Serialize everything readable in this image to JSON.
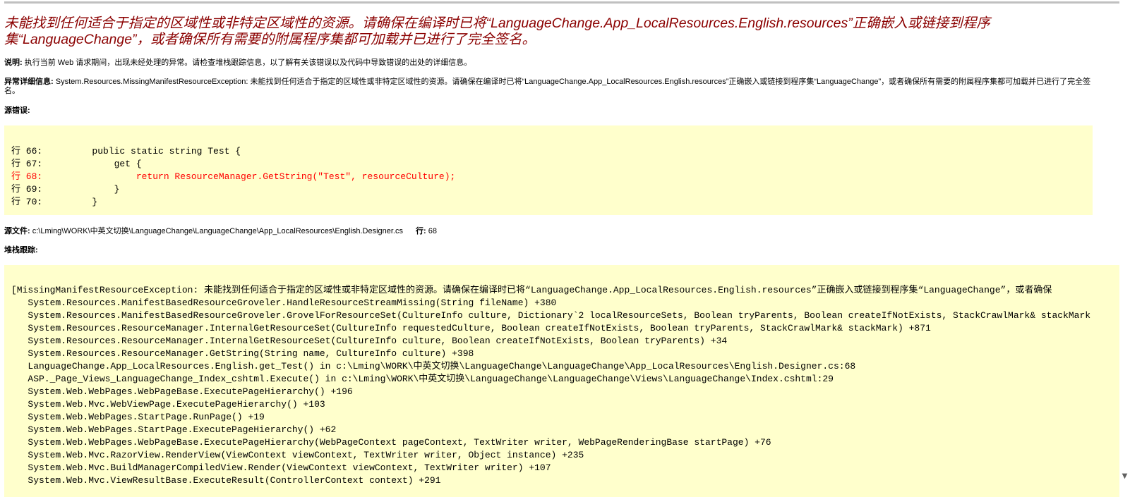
{
  "error": {
    "title": "未能找到任何适合于指定的区域性或非特定区域性的资源。请确保在编译时已将“LanguageChange.App_LocalResources.English.resources”正确嵌入或链接到程序集“LanguageChange”，或者确保所有需要的附属程序集都可加载并已进行了完全签名。",
    "description_label": "说明:",
    "description": " 执行当前 Web 请求期间，出现未经处理的异常。请检查堆栈跟踪信息，以了解有关该错误以及代码中导致错误的出处的详细信息。",
    "exception_label": "异常详细信息:",
    "exception": " System.Resources.MissingManifestResourceException: 未能找到任何适合于指定的区域性或非特定区域性的资源。请确保在编译时已将“LanguageChange.App_LocalResources.English.resources”正确嵌入或链接到程序集“LanguageChange”，或者确保所有需要的附属程序集都可加载并已进行了完全签名。",
    "source_error_label": "源错误:",
    "source_lines": [
      {
        "text": "行 66:         public static string Test {"
      },
      {
        "text": "行 67:             get {"
      },
      {
        "text": "行 68:                 return ResourceManager.GetString(\"Test\", resourceCulture);"
      },
      {
        "text": "行 69:             }"
      },
      {
        "text": "行 70:         }"
      }
    ],
    "source_file_label": "源文件:",
    "source_file": " c:\\Lming\\WORK\\中英文切换\\LanguageChange\\LanguageChange\\App_LocalResources\\English.Designer.cs",
    "line_label": "行:",
    "line_number": " 68",
    "stack_trace_label": "堆栈跟踪:",
    "stack_lines": [
      "[MissingManifestResourceException: 未能找到任何适合于指定的区域性或非特定区域性的资源。请确保在编译时已将“LanguageChange.App_LocalResources.English.resources”正确嵌入或链接到程序集“LanguageChange”，或者确保",
      "   System.Resources.ManifestBasedResourceGroveler.HandleResourceStreamMissing(String fileName) +380",
      "   System.Resources.ManifestBasedResourceGroveler.GrovelForResourceSet(CultureInfo culture, Dictionary`2 localResourceSets, Boolean tryParents, Boolean createIfNotExists, StackCrawlMark& stackMark",
      "   System.Resources.ResourceManager.InternalGetResourceSet(CultureInfo requestedCulture, Boolean createIfNotExists, Boolean tryParents, StackCrawlMark& stackMark) +871",
      "   System.Resources.ResourceManager.InternalGetResourceSet(CultureInfo culture, Boolean createIfNotExists, Boolean tryParents) +34",
      "   System.Resources.ResourceManager.GetString(String name, CultureInfo culture) +398",
      "   LanguageChange.App_LocalResources.English.get_Test() in c:\\Lming\\WORK\\中英文切换\\LanguageChange\\LanguageChange\\App_LocalResources\\English.Designer.cs:68",
      "   ASP._Page_Views_LanguageChange_Index_cshtml.Execute() in c:\\Lming\\WORK\\中英文切换\\LanguageChange\\LanguageChange\\Views\\LanguageChange\\Index.cshtml:29",
      "   System.Web.WebPages.WebPageBase.ExecutePageHierarchy() +196",
      "   System.Web.Mvc.WebViewPage.ExecutePageHierarchy() +103",
      "   System.Web.WebPages.StartPage.RunPage() +19",
      "   System.Web.WebPages.StartPage.ExecutePageHierarchy() +62",
      "   System.Web.WebPages.WebPageBase.ExecutePageHierarchy(WebPageContext pageContext, TextWriter writer, WebPageRenderingBase startPage) +76",
      "   System.Web.Mvc.RazorView.RenderView(ViewContext viewContext, TextWriter writer, Object instance) +235",
      "   System.Web.Mvc.BuildManagerCompiledView.Render(ViewContext viewContext, TextWriter writer) +107",
      "   System.Web.Mvc.ViewResultBase.ExecuteResult(ControllerContext context) +291"
    ]
  },
  "colors": {
    "title": "#8b0000",
    "code_background": "#ffffcc",
    "error_line": "#ff0000"
  },
  "icons": {
    "scroll_down": "chevron-down-icon"
  }
}
